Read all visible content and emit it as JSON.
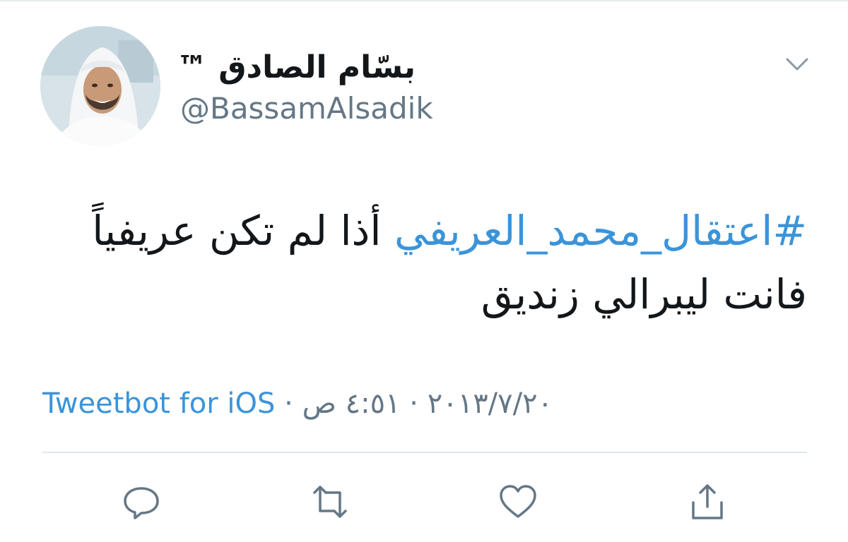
{
  "tweet": {
    "author": {
      "display_name": "بسّام الصادق",
      "trademark": "™",
      "handle": "@BassamAlsadik"
    },
    "text": {
      "hashtag": "#اعتقال_محمد_العريفي",
      "line1_rest": "أذا لم تكن عريفياً",
      "line2": "فانت ليبرالي زنديق"
    },
    "meta": {
      "time": "٤:٥١ ص",
      "separator": "·",
      "date": "٢٠١٣/٧/٢٠",
      "source": "Tweetbot for iOS"
    },
    "actions": [
      "reply-icon",
      "retweet-icon",
      "like-icon",
      "share-icon"
    ]
  },
  "colors": {
    "link": "#3b94d9",
    "text": "#14171a",
    "secondary": "#657786",
    "divider": "#e1e8ed",
    "icon": "#657786"
  }
}
